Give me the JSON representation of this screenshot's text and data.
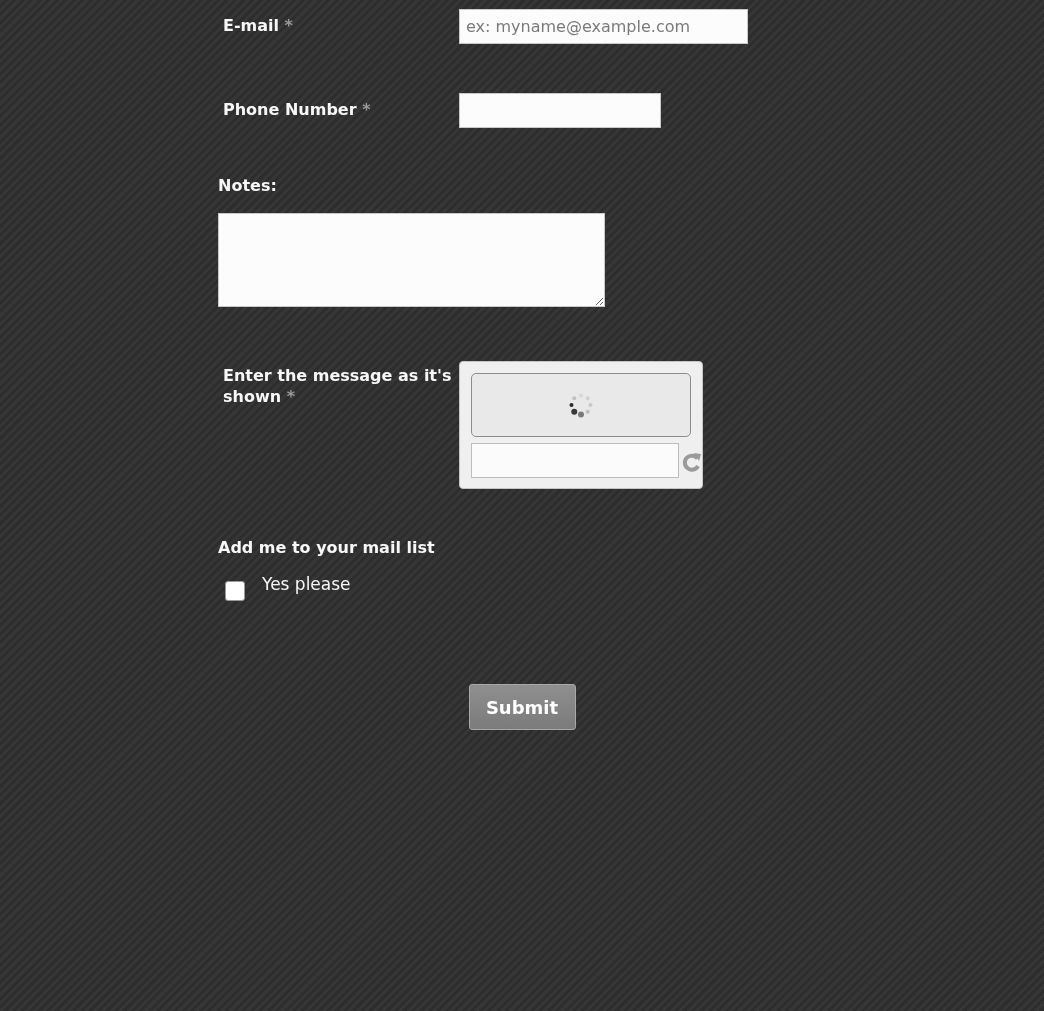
{
  "fields": [
    {
      "kind": "email",
      "label": "E-mail",
      "required_mark": "*",
      "placeholder": "ex: myname@example.com"
    },
    {
      "kind": "phone",
      "label": "Phone Number",
      "required_mark": "*"
    },
    {
      "kind": "textarea",
      "label": "Notes:"
    },
    {
      "kind": "captcha",
      "label": "Enter the message as it's shown",
      "required_mark": "*"
    },
    {
      "kind": "checkbox",
      "label": "Add me to your mail list",
      "options": [
        {
          "label": "Yes please",
          "checked": false
        }
      ]
    }
  ],
  "submit": {
    "label": "Submit"
  }
}
